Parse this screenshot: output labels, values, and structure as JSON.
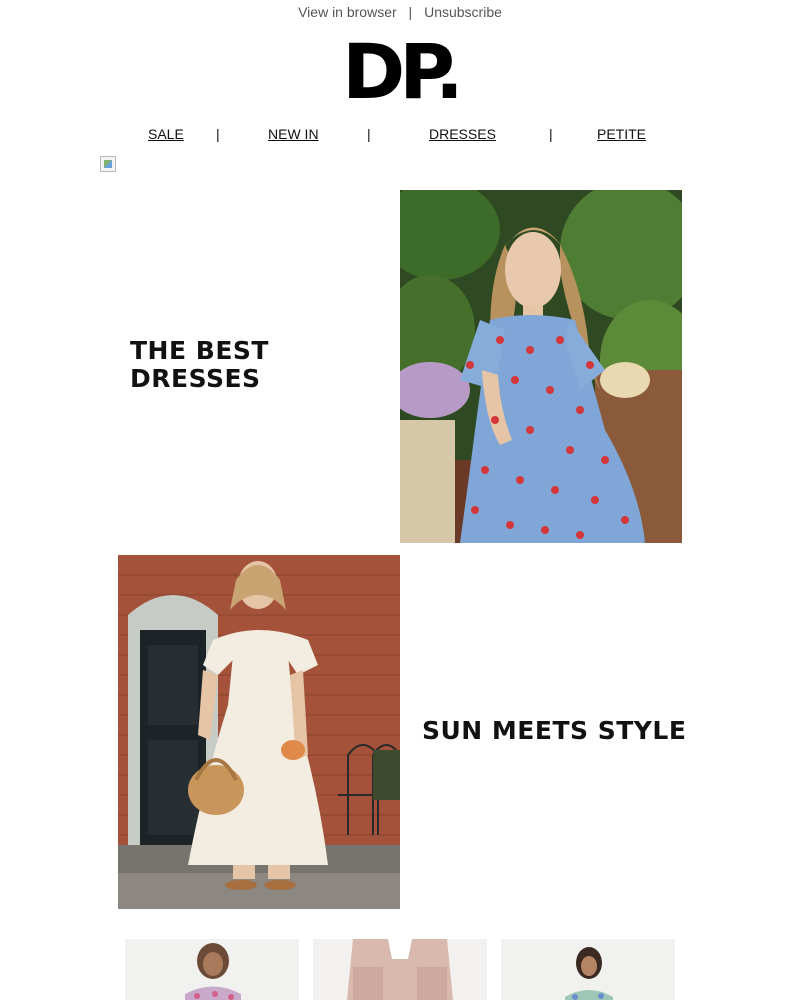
{
  "header": {
    "view_in_browser": "View in browser",
    "separator": "|",
    "unsubscribe": "Unsubscribe",
    "logo": "DP."
  },
  "nav": {
    "items": [
      {
        "label": "SALE"
      },
      {
        "label": "NEW IN"
      },
      {
        "label": "DRESSES"
      },
      {
        "label": "PETITE"
      }
    ],
    "divider": "|"
  },
  "sections": [
    {
      "title_line1": "THE BEST",
      "title_line2": "DRESSES"
    },
    {
      "title": "SUN MEETS STYLE"
    }
  ],
  "colors": {
    "text": "#111111",
    "muted": "#555555",
    "dress_blue": "#7fa6d6",
    "dress_cream": "#f3ece0",
    "brick": "#a4533a"
  }
}
